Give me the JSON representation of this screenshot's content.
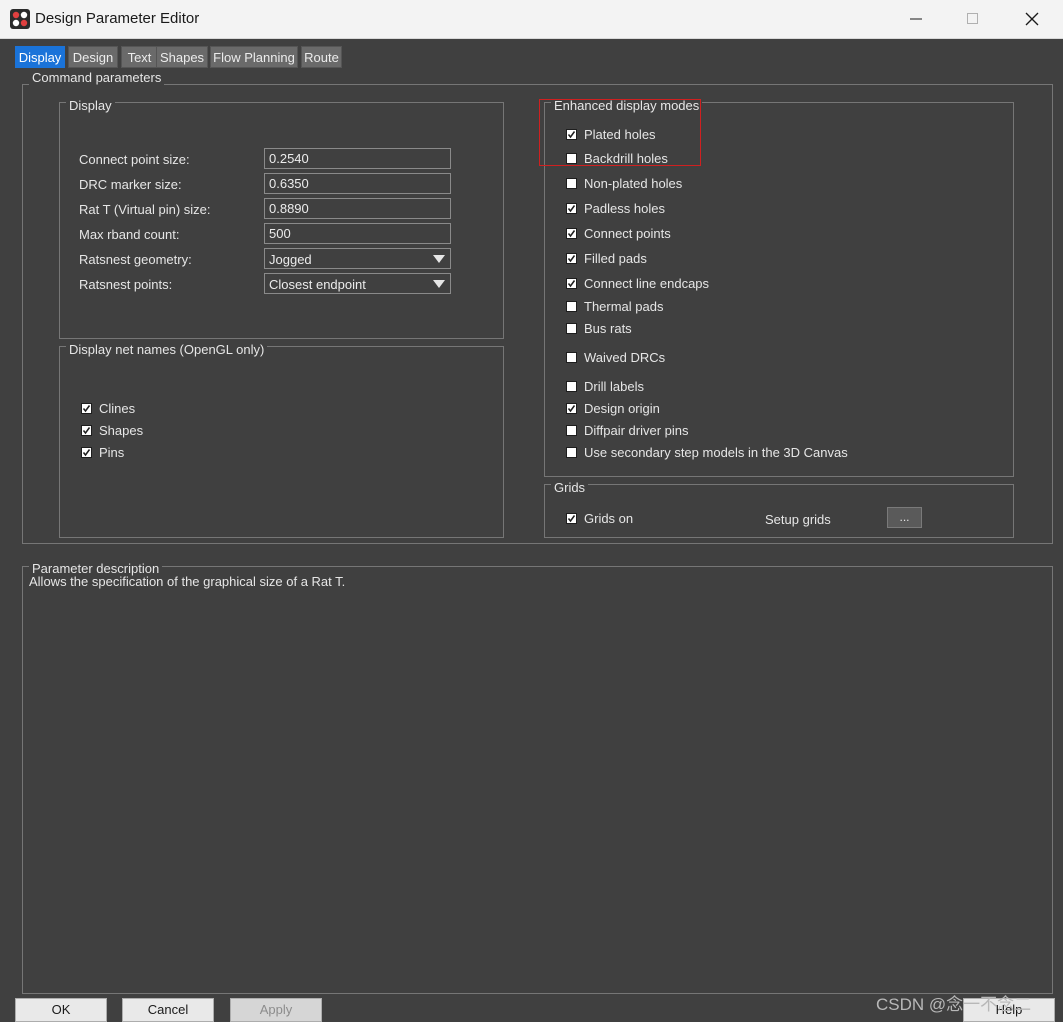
{
  "window": {
    "title": "Design Parameter Editor"
  },
  "tabs": [
    {
      "label": "Display",
      "active": true
    },
    {
      "label": "Design",
      "active": false
    },
    {
      "label": "Text",
      "active": false
    },
    {
      "label": "Shapes",
      "active": false
    },
    {
      "label": "Flow Planning",
      "active": false
    },
    {
      "label": "Route",
      "active": false
    }
  ],
  "command_parameters": {
    "label": "Command parameters",
    "display_group": {
      "label": "Display",
      "fields": [
        {
          "label": "Connect point size:",
          "value": "0.2540"
        },
        {
          "label": "DRC marker size:",
          "value": "0.6350"
        },
        {
          "label": "Rat T (Virtual pin) size:",
          "value": "0.8890"
        },
        {
          "label": "Max rband count:",
          "value": "500"
        }
      ],
      "combos": [
        {
          "label": "Ratsnest geometry:",
          "value": "Jogged"
        },
        {
          "label": "Ratsnest points:",
          "value": "Closest endpoint"
        }
      ]
    },
    "net_names_group": {
      "label": "Display net names (OpenGL only)",
      "items": [
        {
          "label": "Clines",
          "checked": true
        },
        {
          "label": "Shapes",
          "checked": true
        },
        {
          "label": "Pins",
          "checked": true
        }
      ]
    },
    "enhanced_group": {
      "label": "Enhanced display modes",
      "items": [
        {
          "label": "Plated holes",
          "checked": true
        },
        {
          "label": "Backdrill holes",
          "checked": false
        },
        {
          "label": "Non-plated holes",
          "checked": false
        },
        {
          "label": "Padless holes",
          "checked": true
        },
        {
          "label": "Connect points",
          "checked": true
        },
        {
          "label": "Filled pads",
          "checked": true
        },
        {
          "label": "Connect line endcaps",
          "checked": true
        },
        {
          "label": "Thermal pads",
          "checked": false
        },
        {
          "label": "Bus rats",
          "checked": false
        },
        {
          "label": "Waived DRCs",
          "checked": false
        },
        {
          "label": "Drill labels",
          "checked": false
        },
        {
          "label": "Design origin",
          "checked": true
        },
        {
          "label": "Diffpair driver pins",
          "checked": false
        },
        {
          "label": "Use secondary step models in the 3D Canvas",
          "checked": false
        }
      ]
    },
    "grids_group": {
      "label": "Grids",
      "grids_on": {
        "label": "Grids on",
        "checked": true
      },
      "setup_label": "Setup grids",
      "setup_button": "..."
    }
  },
  "parameter_description": {
    "label": "Parameter description",
    "text": "Allows the specification of the graphical size of a Rat T."
  },
  "buttons": {
    "ok": "OK",
    "cancel": "Cancel",
    "apply": "Apply",
    "help": "Help"
  },
  "watermark": "CSDN @念一不念二",
  "colors": {
    "background": "#404040",
    "active_tab": "#1a73d9",
    "highlight": "#d02020"
  }
}
